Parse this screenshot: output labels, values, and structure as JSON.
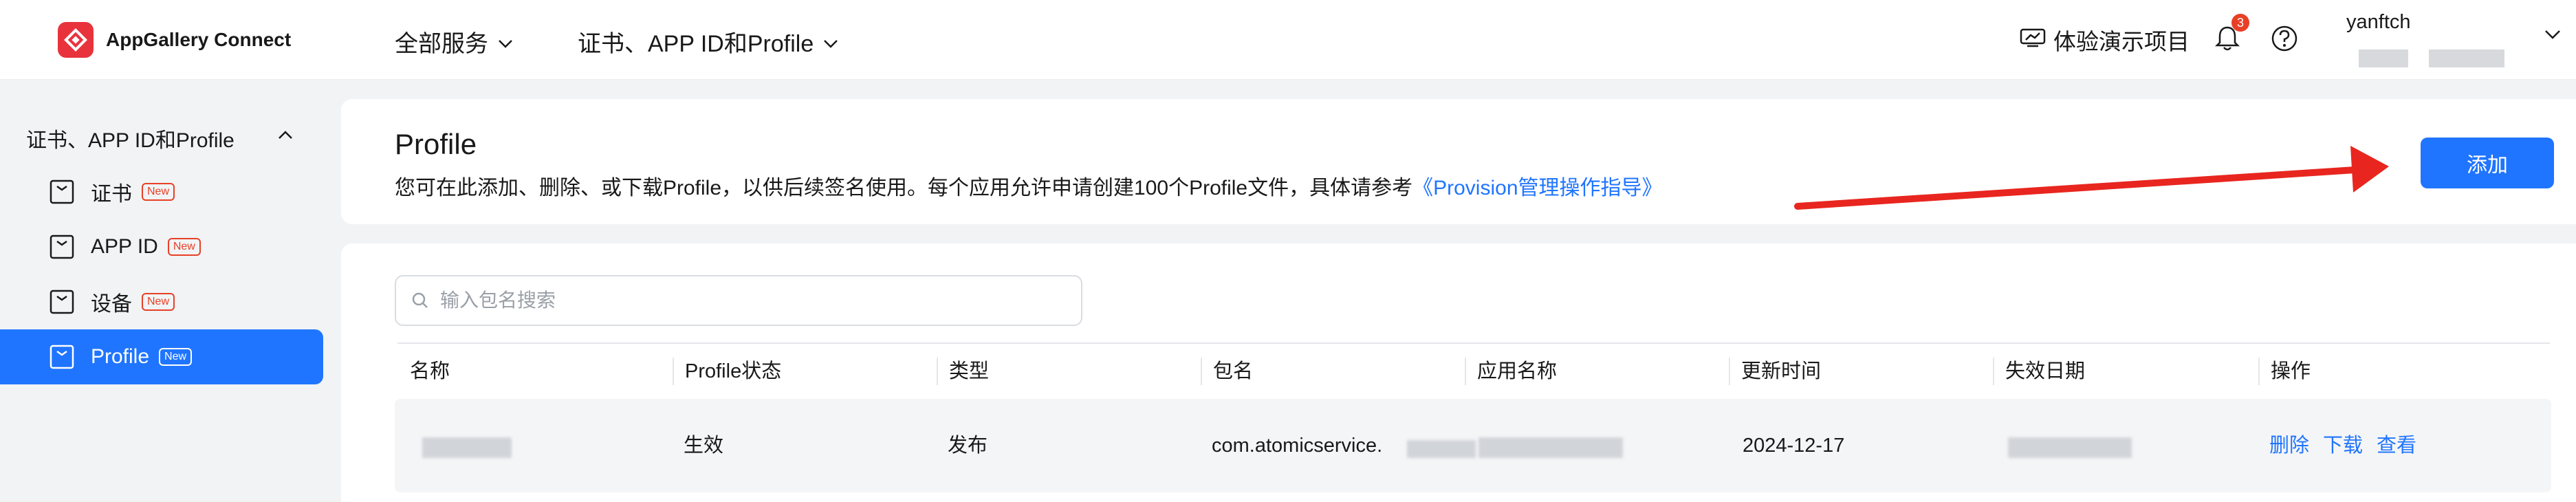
{
  "header": {
    "brand": "AppGallery Connect",
    "nav_all_services": "全部服务",
    "nav_cert": "证书、APP ID和Profile",
    "demo_project": "体验演示项目",
    "bell_count": "3",
    "username": "yanftch"
  },
  "sidebar": {
    "group_label": "证书、APP ID和Profile",
    "items": [
      {
        "label": "证书",
        "badge": "New"
      },
      {
        "label": "APP ID",
        "badge": "New"
      },
      {
        "label": "设备",
        "badge": "New"
      },
      {
        "label": "Profile",
        "badge": "New"
      }
    ]
  },
  "page": {
    "title": "Profile",
    "description": "您可在此添加、删除、或下载Profile，以供后续签名使用。每个应用允许申请创建100个Profile文件，具体请参考",
    "guide_link": "《Provision管理操作指导》",
    "add_button": "添加"
  },
  "search": {
    "placeholder": "输入包名搜索",
    "value": ""
  },
  "table": {
    "columns": [
      "名称",
      "Profile状态",
      "类型",
      "包名",
      "应用名称",
      "更新时间",
      "失效日期",
      "操作"
    ],
    "rows": [
      {
        "status": "生效",
        "type": "发布",
        "package": "com.atomicservice.",
        "updated": "2024-12-17",
        "actions": [
          "删除",
          "下载",
          "查看"
        ]
      }
    ]
  },
  "colors": {
    "accent": "#1f75ff",
    "brand_red": "#e8333d",
    "annotation_arrow": "#e8261f"
  }
}
